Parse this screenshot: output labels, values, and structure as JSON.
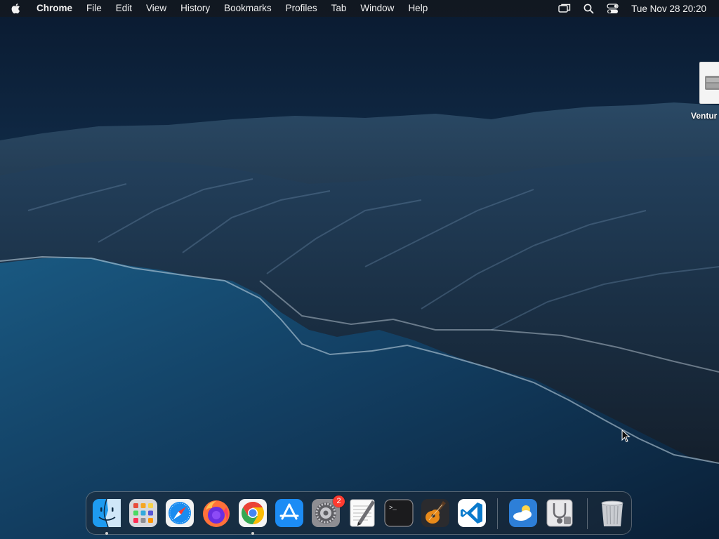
{
  "menubar": {
    "apple_icon": "apple-logo-icon",
    "app_name": "Chrome",
    "menus": [
      "File",
      "Edit",
      "View",
      "History",
      "Bookmarks",
      "Profiles",
      "Tab",
      "Window",
      "Help"
    ],
    "status_icons": [
      "screen-mirroring-icon",
      "search-icon",
      "control-center-icon"
    ],
    "clock": "Tue Nov 28  20:20"
  },
  "desktop": {
    "volume_label": "Ventur"
  },
  "dock": {
    "apps": [
      {
        "name": "finder",
        "icon": "finder-icon",
        "running": true
      },
      {
        "name": "launchpad",
        "icon": "launchpad-icon",
        "running": false
      },
      {
        "name": "safari",
        "icon": "safari-icon",
        "running": false
      },
      {
        "name": "firefox",
        "icon": "firefox-icon",
        "running": false
      },
      {
        "name": "chrome",
        "icon": "chrome-icon",
        "running": true
      },
      {
        "name": "app-store",
        "icon": "app-store-icon",
        "running": false
      },
      {
        "name": "system-settings",
        "icon": "system-settings-icon",
        "running": false,
        "badge": "2"
      },
      {
        "name": "textedit",
        "icon": "textedit-icon",
        "running": false
      },
      {
        "name": "terminal",
        "icon": "terminal-icon",
        "running": false
      },
      {
        "name": "garageband",
        "icon": "garageband-icon",
        "running": false
      },
      {
        "name": "vscode",
        "icon": "vscode-icon",
        "running": false
      },
      {
        "name": "weather",
        "icon": "weather-icon",
        "running": false
      },
      {
        "name": "disk-utility",
        "icon": "disk-utility-icon",
        "running": false
      },
      {
        "name": "trash",
        "icon": "trash-icon",
        "running": false
      }
    ],
    "terminal_prompt": ">_"
  },
  "colors": {
    "menubar_bg": "#14181e",
    "badge": "#ff3b30",
    "sky_top": "#0c1c33",
    "sea": "#16486e"
  }
}
